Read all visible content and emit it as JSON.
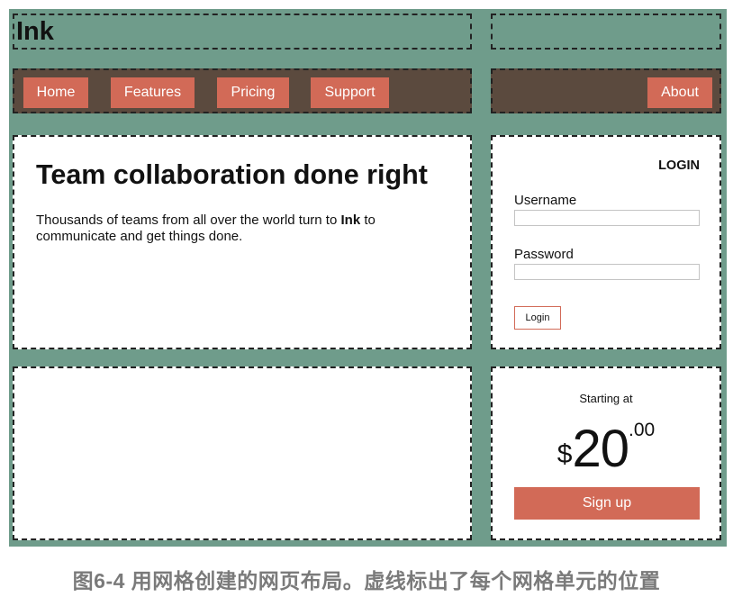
{
  "header": {
    "logo_text": "Ink"
  },
  "nav": {
    "items": [
      {
        "label": "Home"
      },
      {
        "label": "Features"
      },
      {
        "label": "Pricing"
      },
      {
        "label": "Support"
      }
    ],
    "right_item": {
      "label": "About"
    }
  },
  "hero": {
    "title": "Team collaboration done right",
    "text_before": "Thousands of teams from all over the world turn to ",
    "text_bold": "Ink",
    "text_after": " to communicate and get things done."
  },
  "login": {
    "title": "LOGIN",
    "username_label": "Username",
    "password_label": "Password",
    "button_label": "Login"
  },
  "pricing": {
    "caption": "Starting at",
    "currency": "$",
    "amount": "20",
    "cents": ".00",
    "button_label": "Sign up"
  },
  "figure_caption": "图6-4 用网格创建的网页布局。虚线标出了每个网格单元的位置",
  "colors": {
    "frame": "#6f9c8b",
    "nav_bar": "#5b4a3e",
    "accent": "#d26a57"
  }
}
